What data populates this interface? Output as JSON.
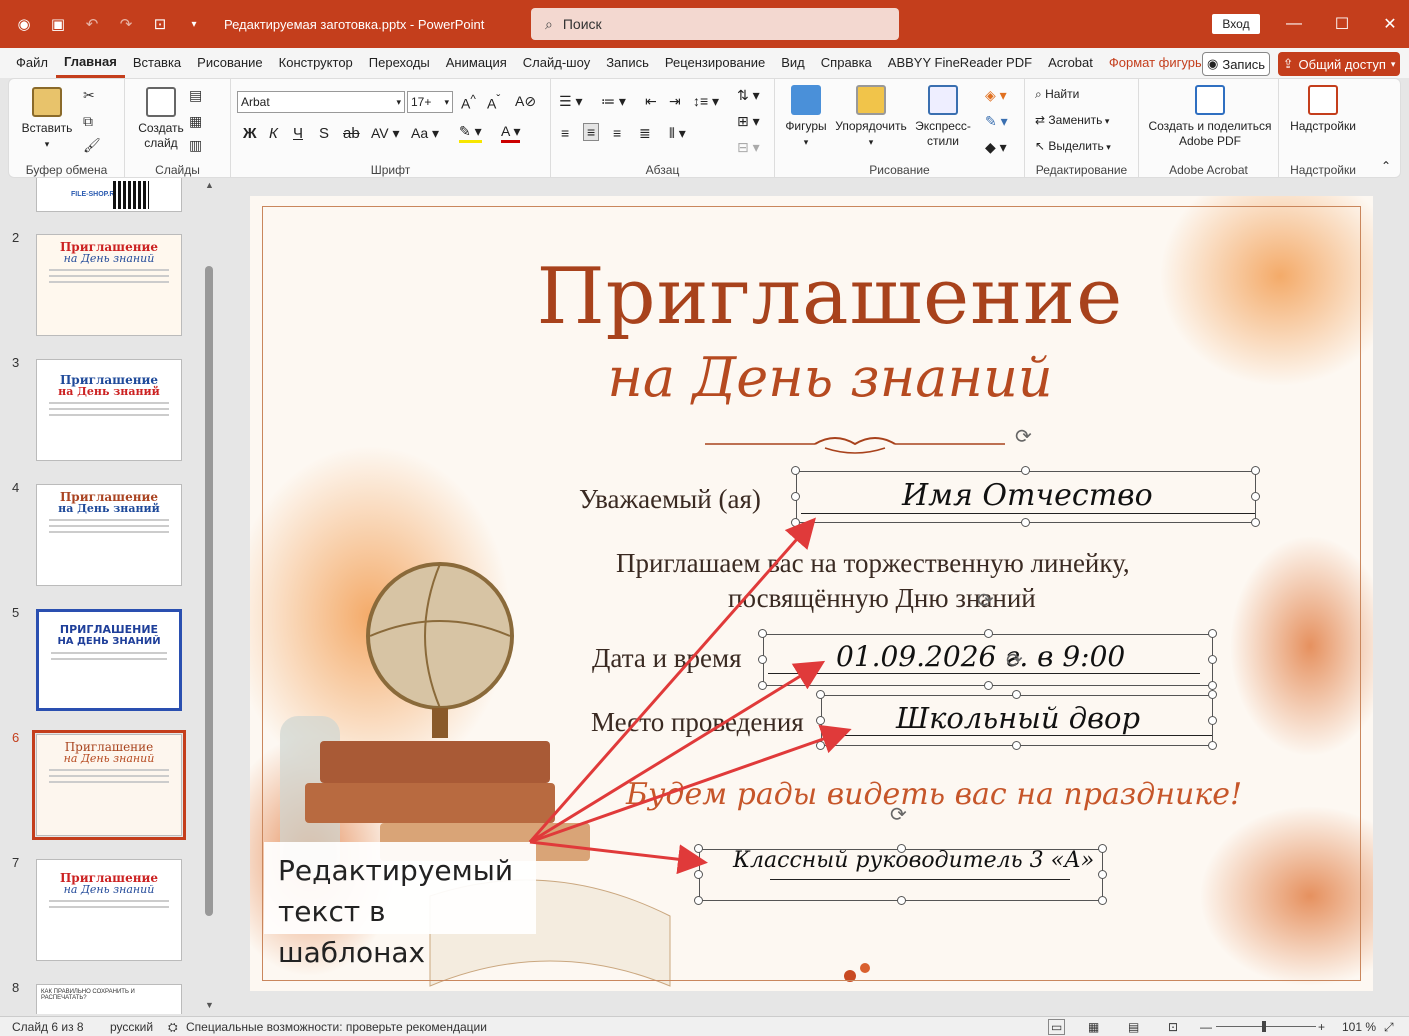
{
  "titlebar": {
    "document_title": "Редактируемая заготовка.pptx  -  PowerPoint",
    "search_placeholder": "Поиск",
    "signin_label": "Вход",
    "icons": [
      "powerpoint-logo-icon",
      "save-icon",
      "undo-icon",
      "redo-icon",
      "present-icon",
      "customize-icon"
    ]
  },
  "menu": {
    "items": [
      "Файл",
      "Главная",
      "Вставка",
      "Рисование",
      "Конструктор",
      "Переходы",
      "Анимация",
      "Слайд-шоу",
      "Запись",
      "Рецензирование",
      "Вид",
      "Справка",
      "ABBYY FineReader PDF",
      "Acrobat",
      "Формат фигуры"
    ],
    "record_label": "Запись",
    "share_label": "Общий доступ"
  },
  "ribbon": {
    "clipboard": {
      "paste_label": "Вставить",
      "group_label": "Буфер обмена"
    },
    "slides": {
      "create_label": "Создать слайд",
      "group_label": "Слайды"
    },
    "font": {
      "font_name": "Arbat",
      "font_size": "17+",
      "group_label": "Шрифт"
    },
    "paragraph": {
      "group_label": "Абзац"
    },
    "drawing": {
      "shapes_label": "Фигуры",
      "arrange_label": "Упорядочить",
      "quick_styles_label": "Экспресс-стили",
      "group_label": "Рисование"
    },
    "editing": {
      "find_label": "Найти",
      "replace_label": "Заменить",
      "select_label": "Выделить",
      "group_label": "Редактирование"
    },
    "acrobat": {
      "create_share_label": "Создать и поделиться Adobe PDF",
      "group_label": "Adobe Acrobat"
    },
    "addins": {
      "addins_label": "Надстройки",
      "group_label": "Надстройки"
    }
  },
  "thumbnails": [
    {
      "num": "2",
      "title": "Приглашение",
      "subtitle": "на День знаний"
    },
    {
      "num": "3",
      "title": "Приглашение",
      "subtitle": "на День знаний"
    },
    {
      "num": "4",
      "title": "Приглашение",
      "subtitle": "на День знаний"
    },
    {
      "num": "5",
      "title": "ПРИГЛАШЕНИЕ",
      "subtitle": "НА ДЕНЬ ЗНАНИЙ"
    },
    {
      "num": "6",
      "title": "Приглашение",
      "subtitle": "на День знаний"
    },
    {
      "num": "7",
      "title": "Приглашение",
      "subtitle": "на День знаний"
    },
    {
      "num": "8",
      "title": "КАК ПРАВИЛЬНО СОХРАНИТЬ И РАСПЕЧАТАТЬ?",
      "subtitle": ""
    }
  ],
  "thumb_top": {
    "label": "FILE-SHOP.RU"
  },
  "slide": {
    "title_line1": "Приглашение",
    "title_line2": "на День знаний",
    "greeting_label": "Уважаемый (ая)",
    "greeting_value": "Имя Отчество",
    "invite_line1": "Приглашаем вас на торжественную линейку,",
    "invite_line2": "посвящённую Дню знаний",
    "date_label": "Дата и время",
    "date_value": "01.09.2026 г. в 9:00",
    "place_label": "Место проведения",
    "place_value": "Школьный двор",
    "closing": "Будем рады видеть вас на празднике!",
    "signature_value": "Классный руководитель 3 «А»",
    "callout_line1": "Редактируемый",
    "callout_line2": "текст в шаблонах"
  },
  "statusbar": {
    "slide_info": "Слайд 6 из 8",
    "language": "русский",
    "accessibility": "Специальные возможности: проверьте рекомендации",
    "zoom": "101 %"
  },
  "colors": {
    "accent": "#c43e1c",
    "title": "#a8421c",
    "arrow": "#e03a3a"
  }
}
